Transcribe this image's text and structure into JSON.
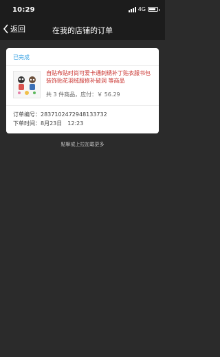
{
  "status_bar": {
    "time": "10:29",
    "network": "4G",
    "battery_level": 0.85
  },
  "nav": {
    "back_label": "返回",
    "title": "在我的店铺的订单"
  },
  "order": {
    "status": "已完成",
    "product_title": "自贴布贴时尚可爱卡通刺绣补丁贴衣服书包装饰贴花羽绒服修补破洞 等商品",
    "summary": "共 3 件商品，应付：￥ 56.29",
    "order_number": "订单编号：2837102472948133732",
    "order_time": "下单时间：8月23日　12:23"
  },
  "footer": {
    "load_more": "點擊或上拉加載更多"
  },
  "colors": {
    "accent": "#3aa3e3",
    "title_red": "#c9302c",
    "background": "#2b2b2b",
    "bar": "#1c1c1c"
  }
}
